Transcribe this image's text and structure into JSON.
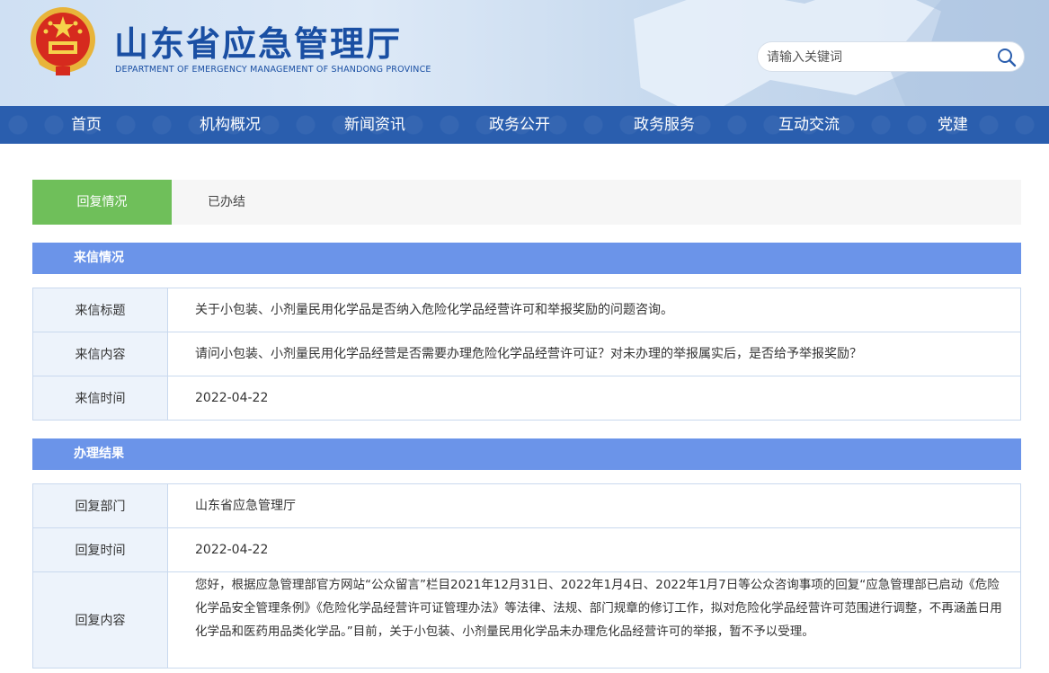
{
  "header": {
    "title": "山东省应急管理厅",
    "subtitle": "DEPARTMENT OF EMERGENCY MANAGEMENT OF SHANDONG PROVINCE",
    "search_placeholder": "请输入关键词",
    "emblem_icon": "national-emblem-icon",
    "search_icon": "search-icon"
  },
  "nav": {
    "items": [
      "首页",
      "机构概况",
      "新闻资讯",
      "政务公开",
      "政务服务",
      "互动交流",
      "党建"
    ]
  },
  "status": {
    "label": "回复情况",
    "value": "已办结"
  },
  "letter": {
    "section_title": "来信情况",
    "rows": [
      {
        "key": "来信标题",
        "value": "关于小包装、小剂量民用化学品是否纳入危险化学品经营许可和举报奖励的问题咨询。"
      },
      {
        "key": "来信内容",
        "value": "请问小包装、小剂量民用化学品经营是否需要办理危险化学品经营许可证？对未办理的举报属实后，是否给予举报奖励？"
      },
      {
        "key": "来信时间",
        "value": "2022-04-22"
      }
    ]
  },
  "result": {
    "section_title": "办理结果",
    "rows": [
      {
        "key": "回复部门",
        "value": "山东省应急管理厅"
      },
      {
        "key": "回复时间",
        "value": "2022-04-22"
      },
      {
        "key": "回复内容",
        "value": "您好，根据应急管理部官方网站“公众留言”栏目2021年12月31日、2022年1月4日、2022年1月7日等公众咨询事项的回复“应急管理部已启动《危险化学品安全管理条例》《危险化学品经营许可证管理办法》等法律、法规、部门规章的修订工作，拟对危险化学品经营许可范围进行调整，不再涵盖日用化学品和医药用品类化学品。”目前，关于小包装、小剂量民用化学品未办理危化品经营许可的举报，暂不予以受理。"
      }
    ]
  },
  "colors": {
    "nav_bg": "#2a5eae",
    "status_green": "#6fbf5a",
    "section_blue": "#6b94e9",
    "title_blue": "#1a4fa3"
  }
}
